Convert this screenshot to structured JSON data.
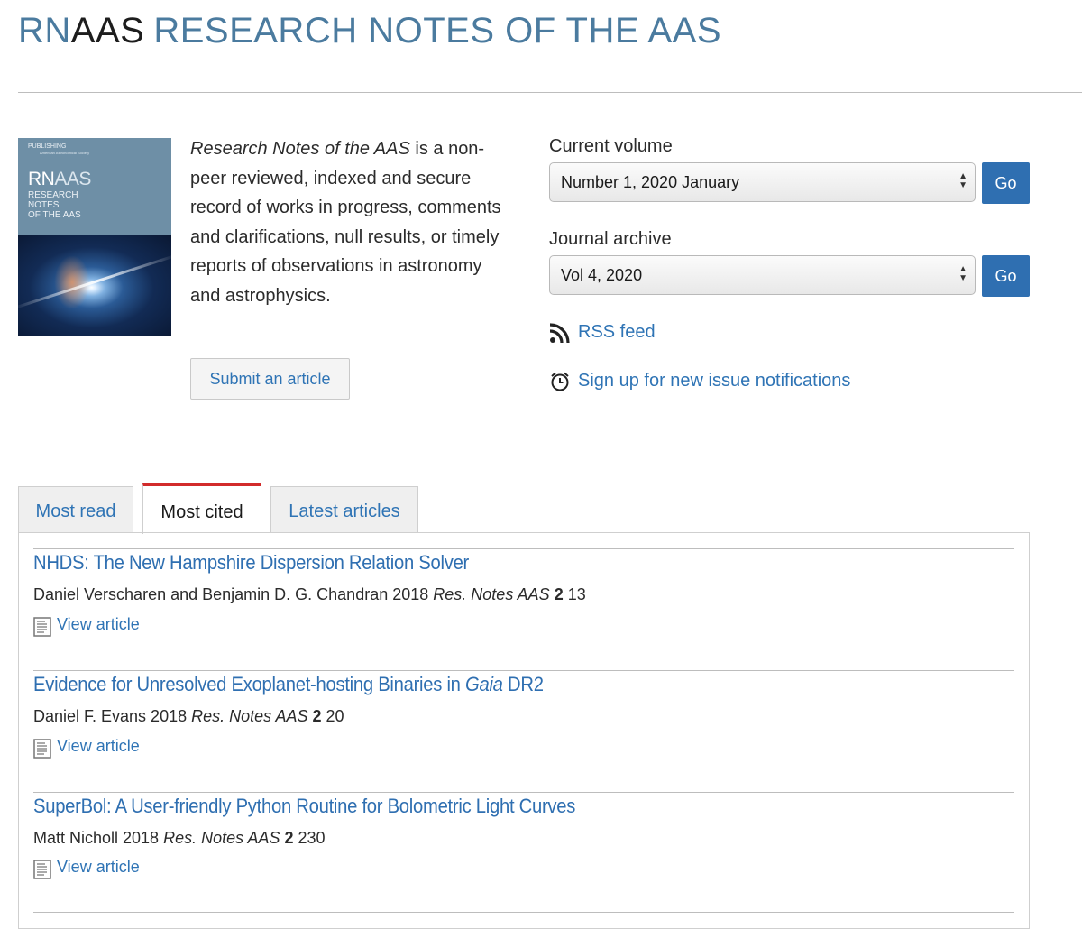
{
  "header": {
    "brand_rn": "RN",
    "brand_aas": "AAS",
    "brand_full": "RESEARCH NOTES OF THE AAS"
  },
  "cover": {
    "publisher": "PUBLISHING",
    "publisher_sub": "American Astronomical Society",
    "title_rn": "RN",
    "title_aas": "AAS",
    "subtitle_1": "RESEARCH",
    "subtitle_2": "NOTES",
    "subtitle_3": "OF THE AAS"
  },
  "intro": {
    "journal_name": "Research Notes of the AAS",
    "description": " is a non-peer reviewed, indexed and secure record of works in progress, comments and clarifications, null results, or timely reports of observations in astronomy and astrophysics."
  },
  "submit_label": "Submit an article",
  "current_volume": {
    "label": "Current volume",
    "selected": "Number 1, 2020 January",
    "go_label": "Go"
  },
  "journal_archive": {
    "label": "Journal archive",
    "selected": "Vol 4, 2020",
    "go_label": "Go"
  },
  "rss_label": "RSS feed",
  "notify_label": "Sign up for new issue notifications",
  "tabs": [
    {
      "label": "Most read"
    },
    {
      "label": "Most cited"
    },
    {
      "label": "Latest articles"
    }
  ],
  "articles": [
    {
      "title": "NHDS: The New Hampshire Dispersion Relation Solver",
      "authors": "Daniel Verscharen and Benjamin D. G. Chandran 2018 ",
      "journal": "Res. Notes AAS",
      "volume": "2",
      "page": "13",
      "view_label": "View article"
    },
    {
      "title_pre": "Evidence for Unresolved Exoplanet-hosting Binaries in ",
      "title_em": "Gaia",
      "title_post": " DR2",
      "authors": "Daniel F. Evans 2018 ",
      "journal": "Res. Notes AAS",
      "volume": "2",
      "page": "20",
      "view_label": "View article"
    },
    {
      "title": "SuperBol: A User-friendly Python Routine for Bolometric Light Curves",
      "authors": "Matt Nicholl 2018 ",
      "journal": "Res. Notes AAS",
      "volume": "2",
      "page": "230",
      "view_label": "View article"
    }
  ]
}
